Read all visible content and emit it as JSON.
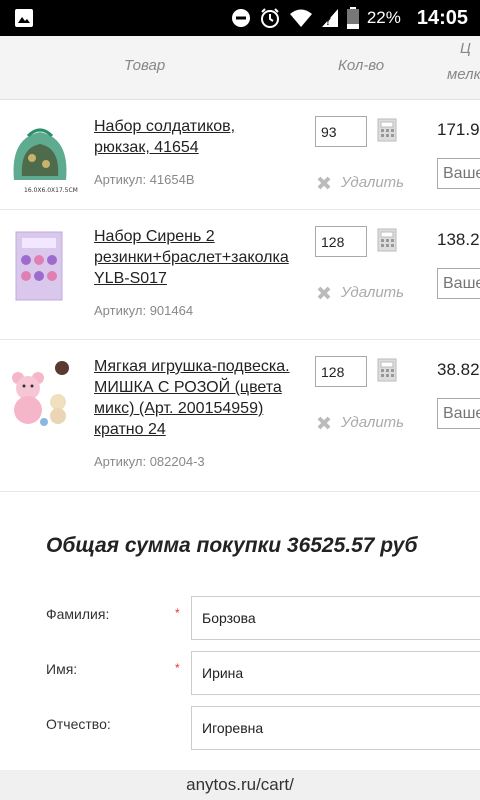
{
  "status_bar": {
    "battery_percent": "22%",
    "time": "14:05"
  },
  "table": {
    "headers": {
      "product": "Товар",
      "qty": "Кол-во",
      "price_top": "Ц",
      "price_sub": "мелк"
    }
  },
  "items": [
    {
      "name": "Набор солдатиков, рюкзак, 41654",
      "article": "Артикул: 41654B",
      "qty": "93",
      "delete": "Удалить",
      "price": "171.9",
      "your_price_placeholder": "Ваше",
      "thumb_caption": "16.0X6.0X17.5CM"
    },
    {
      "name": "Набор Сирень 2 резинки+браслет+заколка YLB-S017",
      "article": "Артикул: 901464",
      "qty": "128",
      "delete": "Удалить",
      "price": "138.2",
      "your_price_placeholder": "Ваше"
    },
    {
      "name": "Мягкая игрушка-подвеска. МИШКА С РОЗОЙ (цвета микс) (Арт. 200154959) кратно 24",
      "article": "Артикул: 082204-3",
      "qty": "128",
      "delete": "Удалить",
      "price": "38.82",
      "your_price_placeholder": "Ваше"
    }
  ],
  "total": {
    "text": "Общая сумма покупки 36525.57 руб"
  },
  "form": {
    "last_name": {
      "label": "Фамилия:",
      "value": "Борзова",
      "required": "*"
    },
    "first_name": {
      "label": "Имя:",
      "value": "Ирина",
      "required": "*"
    },
    "patronymic": {
      "label": "Отчество:",
      "value": "Игоревна"
    }
  },
  "browser": {
    "url": "anytos.ru/cart/"
  }
}
